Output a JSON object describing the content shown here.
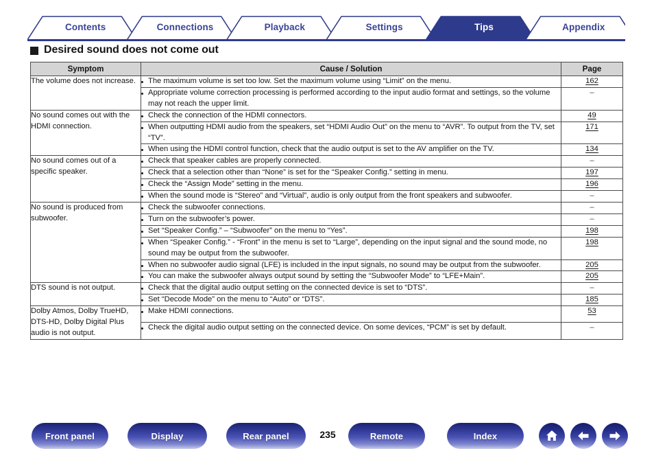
{
  "tabs": [
    {
      "label": "Contents",
      "active": false
    },
    {
      "label": "Connections",
      "active": false
    },
    {
      "label": "Playback",
      "active": false
    },
    {
      "label": "Settings",
      "active": false
    },
    {
      "label": "Tips",
      "active": true
    },
    {
      "label": "Appendix",
      "active": false
    }
  ],
  "heading": {
    "text": "Desired sound does not come out"
  },
  "table": {
    "headers": {
      "symptom": "Symptom",
      "cause": "Cause / Solution",
      "page": "Page"
    },
    "groups": [
      {
        "symptom": "The volume does not increase.",
        "rows": [
          {
            "cause": "The maximum volume is set too low. Set the maximum volume using “Limit” on the menu.",
            "page": "162",
            "is_link": true
          },
          {
            "cause": "Appropriate volume correction processing is performed according to the input audio format and settings, so the volume may not reach the upper limit.",
            "page": "–",
            "is_link": false
          }
        ]
      },
      {
        "symptom": "No sound comes out with the HDMI connection.",
        "rows": [
          {
            "cause": "Check the connection of the HDMI connectors.",
            "page": "49",
            "is_link": true
          },
          {
            "cause": "When outputting HDMI audio from the speakers, set “HDMI Audio Out” on the menu to “AVR”. To output from the TV, set “TV”.",
            "page": "171",
            "is_link": true
          },
          {
            "cause": "When using the HDMI control function, check that the audio output is set to the AV amplifier on the TV.",
            "page": "134",
            "is_link": true
          }
        ]
      },
      {
        "symptom": "No sound comes out of a specific speaker.",
        "rows": [
          {
            "cause": "Check that speaker cables are properly connected.",
            "page": "–",
            "is_link": false
          },
          {
            "cause": "Check that a selection other than “None” is set for the “Speaker Config.” setting in menu.",
            "page": "197",
            "is_link": true
          },
          {
            "cause": "Check the “Assign Mode” setting in the menu.",
            "page": "196",
            "is_link": true
          },
          {
            "cause": "When the sound mode is “Stereo” and “Virtual”, audio is only output from the front speakers and subwoofer.",
            "page": "–",
            "is_link": false
          }
        ]
      },
      {
        "symptom": "No sound is produced from subwoofer.",
        "rows": [
          {
            "cause": "Check the subwoofer connections.",
            "page": "–",
            "is_link": false
          },
          {
            "cause": "Turn on the subwoofer’s power.",
            "page": "–",
            "is_link": false
          },
          {
            "cause": "Set “Speaker Config.” – “Subwoofer” on the menu to “Yes”.",
            "page": "198",
            "is_link": true
          },
          {
            "cause": "When “Speaker Config.” - “Front” in the menu is set to “Large”, depending on the input signal and the sound mode, no sound may be output from the subwoofer.",
            "page": "198",
            "is_link": true
          },
          {
            "cause": "When no subwoofer audio signal (LFE) is included in the input signals, no sound may be output from the subwoofer.",
            "page": "205",
            "is_link": true
          },
          {
            "cause": "You can make the subwoofer always output sound by setting the “Subwoofer Mode” to “LFE+Main”.",
            "page": "205",
            "is_link": true
          }
        ]
      },
      {
        "symptom": "DTS sound is not output.",
        "rows": [
          {
            "cause": "Check that the digital audio output setting on the connected device is set to “DTS”.",
            "page": "–",
            "is_link": false
          },
          {
            "cause": "Set “Decode Mode” on the menu to “Auto” or “DTS”.",
            "page": "185",
            "is_link": true
          }
        ]
      },
      {
        "symptom": "Dolby Atmos, Dolby TrueHD, DTS-HD, Dolby Digital Plus audio is not output.",
        "rows": [
          {
            "cause": "Make HDMI connections.",
            "page": "53",
            "is_link": true
          },
          {
            "cause": "Check the digital audio output setting on the connected device. On some devices, “PCM” is set by default.",
            "page": "–",
            "is_link": false
          }
        ]
      }
    ]
  },
  "bottom_nav": {
    "page_number": "235",
    "buttons": [
      {
        "label": "Front panel"
      },
      {
        "label": "Display"
      },
      {
        "label": "Rear panel"
      },
      {
        "label": "Remote"
      },
      {
        "label": "Index"
      }
    ],
    "icons": [
      {
        "name": "home-icon"
      },
      {
        "name": "arrow-left-icon"
      },
      {
        "name": "arrow-right-icon"
      }
    ]
  },
  "colors": {
    "tab_active_bg": "#2e3a8c",
    "tab_text": "#3a4396",
    "table_header_bg": "#d4d4d4",
    "button_gradient_top": "#1c2270",
    "button_gradient_bottom": "#c9cde8"
  }
}
